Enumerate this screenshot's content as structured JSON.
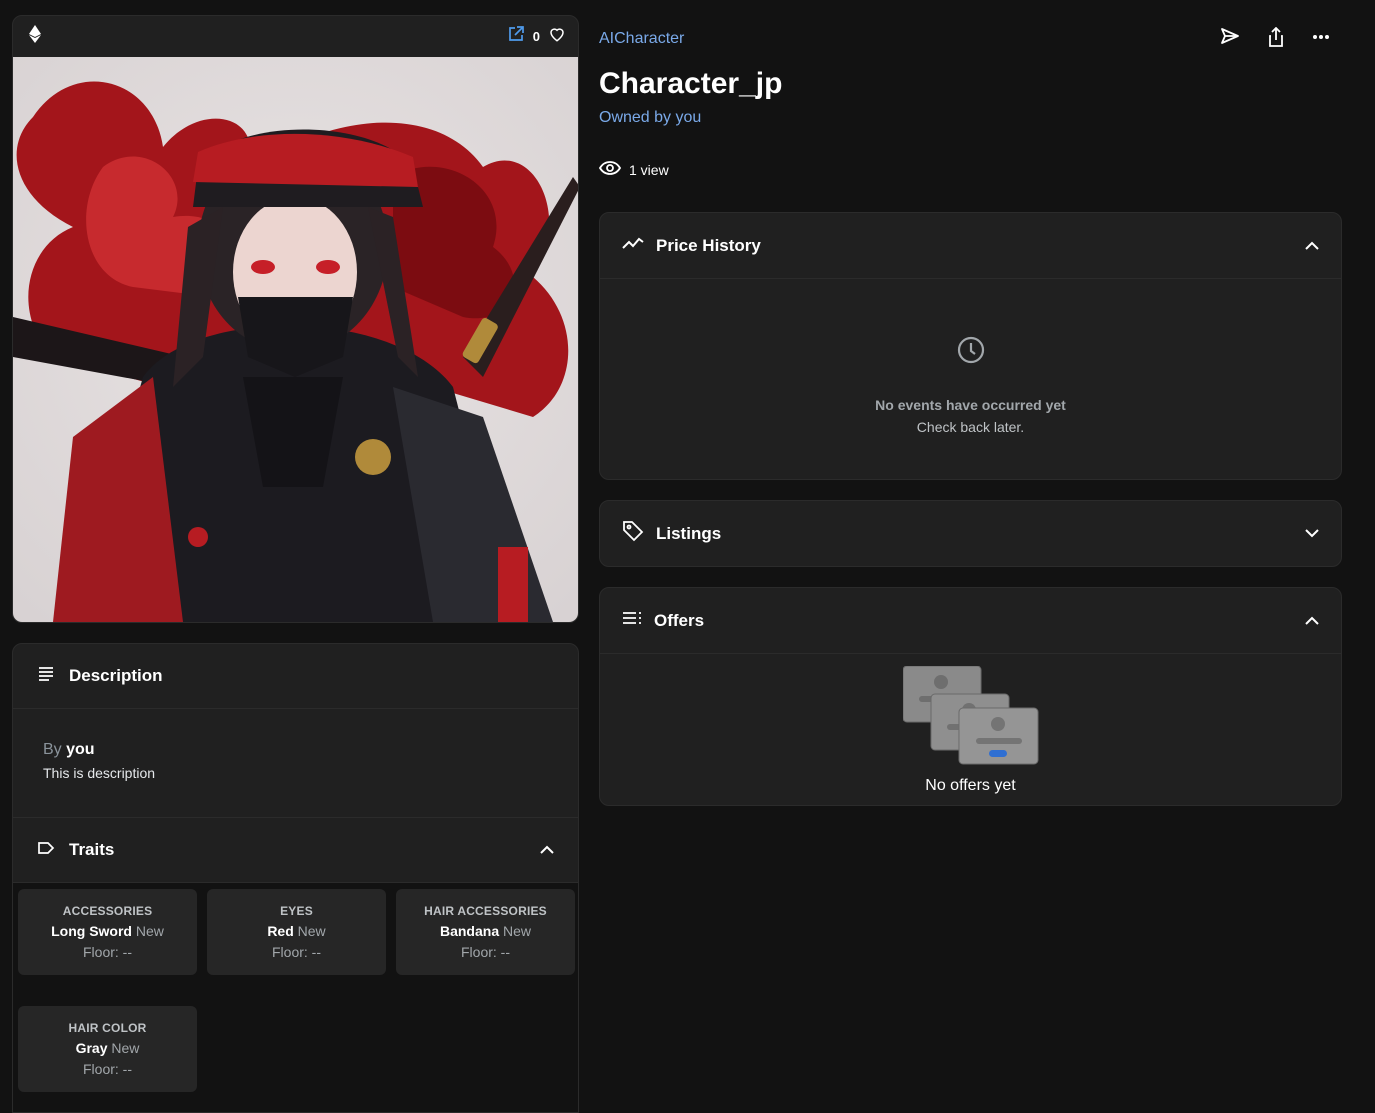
{
  "media": {
    "chain_icon": "ethereum-icon",
    "favorite_count": "0",
    "art_alt": "Anime character in black and red ninja outfit with bandana, face mask and katana"
  },
  "description": {
    "title": "Description",
    "by_label": "By",
    "by_name": "you",
    "text": "This is description"
  },
  "traits": {
    "title": "Traits",
    "items": [
      {
        "type": "ACCESSORIES",
        "value": "Long Sword",
        "tag": "New",
        "floor": "Floor: --"
      },
      {
        "type": "EYES",
        "value": "Red",
        "tag": "New",
        "floor": "Floor: --"
      },
      {
        "type": "HAIR ACCESSORIES",
        "value": "Bandana",
        "tag": "New",
        "floor": "Floor: --"
      },
      {
        "type": "HAIR COLOR",
        "value": "Gray",
        "tag": "New",
        "floor": "Floor: --"
      }
    ]
  },
  "item": {
    "collection": "AICharacter",
    "title": "Character_jp",
    "owned_by_label": "Owned by",
    "owner": "you",
    "views": "1 view"
  },
  "price_history": {
    "title": "Price History",
    "empty_title": "No events have occurred yet",
    "empty_sub": "Check back later."
  },
  "listings": {
    "title": "Listings"
  },
  "offers": {
    "title": "Offers",
    "empty": "No offers yet"
  },
  "colors": {
    "background": "#121212",
    "card": "#202020",
    "border": "#2b2b2b",
    "link": "#7aa9e8"
  }
}
